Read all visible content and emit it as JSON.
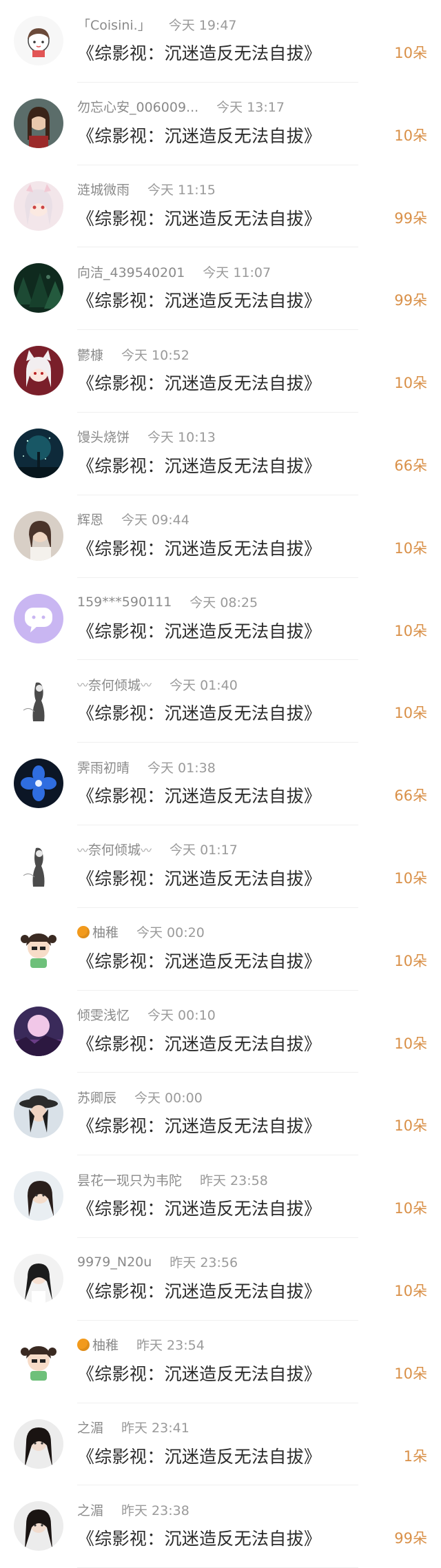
{
  "gifts": [
    {
      "name": "「Coisini.」",
      "time": "今天 19:47",
      "title": "《综影视：沉迷造反无法自拔》",
      "amount": "10朵",
      "avatar": "cartoon-girl-avatar"
    },
    {
      "name": "勿忘心安_006009...",
      "time": "今天 13:17",
      "title": "《综影视：沉迷造反无法自拔》",
      "amount": "10朵",
      "avatar": "girl-portrait-avatar"
    },
    {
      "name": "涟城微雨",
      "time": "今天 11:15",
      "title": "《综影视：沉迷造反无法自拔》",
      "amount": "99朵",
      "avatar": "anime-girl-avatar"
    },
    {
      "name": "向洁_439540201",
      "time": "今天 11:07",
      "title": "《综影视：沉迷造反无法自拔》",
      "amount": "99朵",
      "avatar": "forest-avatar"
    },
    {
      "name": "鬱槺",
      "time": "今天 10:52",
      "title": "《综影视：沉迷造反无法自拔》",
      "amount": "10朵",
      "avatar": "fox-girl-avatar"
    },
    {
      "name": "馒头烧饼",
      "time": "今天 10:13",
      "title": "《综影视：沉迷造反无法自拔》",
      "amount": "66朵",
      "avatar": "starry-tree-avatar"
    },
    {
      "name": "辉恩",
      "time": "今天 09:44",
      "title": "《综影视：沉迷造反无法自拔》",
      "amount": "10朵",
      "avatar": "girl-photo-avatar"
    },
    {
      "name": "159***590111",
      "time": "今天 08:25",
      "title": "《综影视：沉迷造反无法自拔》",
      "amount": "10朵",
      "avatar": "chat-bubble-avatar"
    },
    {
      "name": "奈何倾城",
      "time": "今天 01:40",
      "title": "《综影视：沉迷造反无法自拔》",
      "amount": "10朵",
      "avatar": "ink-figure-avatar",
      "deco": true
    },
    {
      "name": "霁雨初晴",
      "time": "今天 01:38",
      "title": "《综影视：沉迷造反无法自拔》",
      "amount": "66朵",
      "avatar": "blue-flower-avatar"
    },
    {
      "name": "奈何倾城",
      "time": "今天 01:17",
      "title": "《综影视：沉迷造反无法自拔》",
      "amount": "10朵",
      "avatar": "ink-figure-avatar",
      "deco": true
    },
    {
      "name": "柚稚",
      "time": "今天 00:20",
      "title": "《综影视：沉迷造反无法自拔》",
      "amount": "10朵",
      "avatar": "chibi-avatar",
      "orange": true
    },
    {
      "name": "倾雯浅忆",
      "time": "今天 00:10",
      "title": "《综影视：沉迷造反无法自拔》",
      "amount": "10朵",
      "avatar": "moon-night-avatar"
    },
    {
      "name": "苏卿辰",
      "time": "今天 00:00",
      "title": "《综影视：沉迷造反无法自拔》",
      "amount": "10朵",
      "avatar": "hat-girl-avatar"
    },
    {
      "name": "昙花一现只为韦陀",
      "time": "昨天 23:58",
      "title": "《综影视：沉迷造反无法自拔》",
      "amount": "10朵",
      "avatar": "girl-selfie-avatar"
    },
    {
      "name": "9979_N20u",
      "time": "昨天 23:56",
      "title": "《综影视：沉迷造反无法自拔》",
      "amount": "10朵",
      "avatar": "girl-longhair-avatar"
    },
    {
      "name": "柚稚",
      "time": "昨天 23:54",
      "title": "《综影视：沉迷造反无法自拔》",
      "amount": "10朵",
      "avatar": "chibi-avatar",
      "orange": true
    },
    {
      "name": "之湄",
      "time": "昨天 23:41",
      "title": "《综影视：沉迷造反无法自拔》",
      "amount": "1朵",
      "avatar": "dark-hair-avatar"
    },
    {
      "name": "之湄",
      "time": "昨天 23:38",
      "title": "《综影视：沉迷造反无法自拔》",
      "amount": "99朵",
      "avatar": "dark-hair-avatar"
    }
  ],
  "colors": {
    "amount": "#d99048",
    "title": "#2b2b2b",
    "meta": "#8a8a8a",
    "divider": "#efefef",
    "orange-icon": "#f29a1c"
  }
}
